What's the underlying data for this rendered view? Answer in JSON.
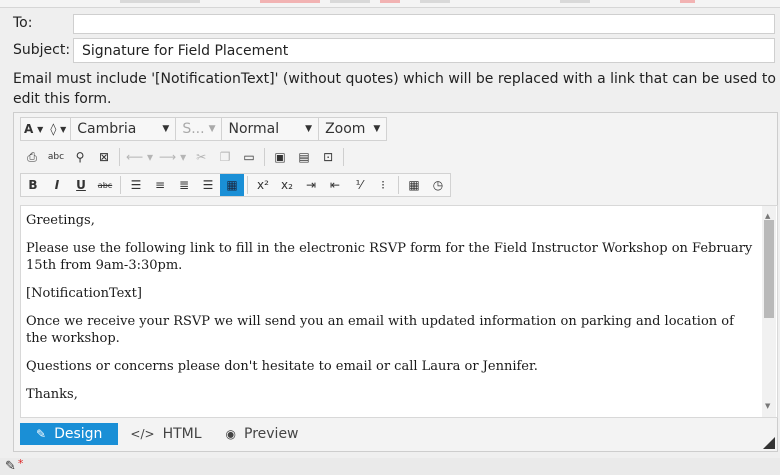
{
  "form": {
    "to_label": "To:",
    "to_value": "",
    "subject_label": "Subject:",
    "subject_value": "Signature for Field Placement",
    "hint": "Email must include '[NotificationText]' (without quotes) which will be replaced with a link that can be used to edit this form."
  },
  "toolbar": {
    "row1": {
      "font_color_icon": "A",
      "highlight_icon": "◊",
      "font_family": "Cambria",
      "font_size": "S...",
      "paragraph": "Normal",
      "zoom": "Zoom"
    },
    "row2": [
      "print-icon",
      "spellcheck-icon",
      "find-icon",
      "select-all-icon",
      "undo-icon",
      "redo-icon",
      "cut-icon",
      "copy-icon",
      "paste-icon",
      "paste-word-icon",
      "paste-text-icon",
      "paste-html-icon"
    ],
    "row3": [
      "bold-icon",
      "italic-icon",
      "underline-icon",
      "strikethrough-icon",
      "align-left-icon",
      "align-center-icon",
      "align-right-icon",
      "justify-icon",
      "format-stripper-icon",
      "superscript-icon",
      "subscript-icon",
      "indent-icon",
      "outdent-icon",
      "numbered-list-icon",
      "bulleted-list-icon",
      "insert-date-icon",
      "insert-time-icon"
    ],
    "labels": {
      "bold": "B",
      "italic": "I",
      "underline": "U",
      "strike": "abc",
      "superscript": "x²",
      "subscript": "x₂",
      "spell": "abc"
    }
  },
  "content": {
    "paragraphs": [
      "Greetings,",
      "Please use the following link to fill in the electronic RSVP form for the Field Instructor Workshop on February 15th from 9am-3:30pm.",
      "[NotificationText]",
      "Once we receive your RSVP we will send you an email with updated information on parking and location of the workshop.",
      "Questions or concerns please don't hesitate to email or call Laura or Jennifer.",
      "Thanks,"
    ]
  },
  "modes": {
    "design": "Design",
    "html": "HTML",
    "preview": "Preview",
    "active": "design"
  },
  "colors": {
    "accent": "#1a8fd6",
    "required": "#dd2222"
  }
}
